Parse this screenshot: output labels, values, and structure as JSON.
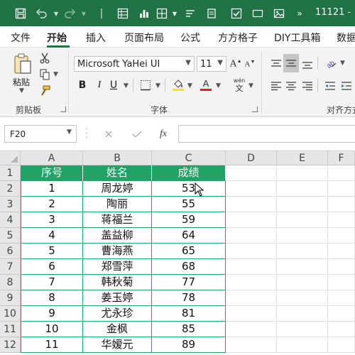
{
  "titlebar": {
    "title": "11121 -",
    "bg_color": "#217346",
    "icons": [
      "save-icon",
      "undo-icon",
      "redo-icon",
      "table-icon",
      "chart-icon",
      "grid-icon",
      "sort-icon",
      "checkbox-icon",
      "rect-icon",
      "image-icon"
    ]
  },
  "tabs": {
    "items": [
      "文件",
      "开始",
      "插入",
      "页面布局",
      "公式",
      "方方格子",
      "DIY工具箱",
      "数据"
    ],
    "active": "开始"
  },
  "ribbon": {
    "paste_label": "粘贴",
    "clipboard_label": "剪贴板",
    "font_label": "字体",
    "align_label": "对齐方式",
    "font_name": "Microsoft YaHei UI",
    "font_size": "11",
    "bold": "B",
    "italic": "I",
    "underline": "U",
    "phonetic_top": "wén",
    "phonetic_bottom": "文",
    "font_color": "#e02020",
    "highlight_color": "#ffe600"
  },
  "formula_bar": {
    "name_box": "F20",
    "fx": "fx",
    "formula": ""
  },
  "grid": {
    "columns": [
      "A",
      "B",
      "C",
      "D",
      "E",
      "F"
    ],
    "rows": [
      "1",
      "2",
      "3",
      "4",
      "5",
      "6",
      "7",
      "8",
      "9",
      "10",
      "11",
      "12"
    ],
    "table_color": "#21a366",
    "header": [
      "序号",
      "姓名",
      "成绩"
    ],
    "data": [
      [
        "1",
        "周龙婷",
        "53"
      ],
      [
        "2",
        "陶丽",
        "55"
      ],
      [
        "3",
        "蒋福兰",
        "59"
      ],
      [
        "4",
        "盖益柳",
        "64"
      ],
      [
        "5",
        "曹海燕",
        "65"
      ],
      [
        "6",
        "郑雪萍",
        "68"
      ],
      [
        "7",
        "韩秋菊",
        "77"
      ],
      [
        "8",
        "姜玉婷",
        "78"
      ],
      [
        "9",
        "尤永珍",
        "81"
      ],
      [
        "10",
        "金枫",
        "85"
      ],
      [
        "11",
        "华嫒元",
        "89"
      ]
    ]
  }
}
